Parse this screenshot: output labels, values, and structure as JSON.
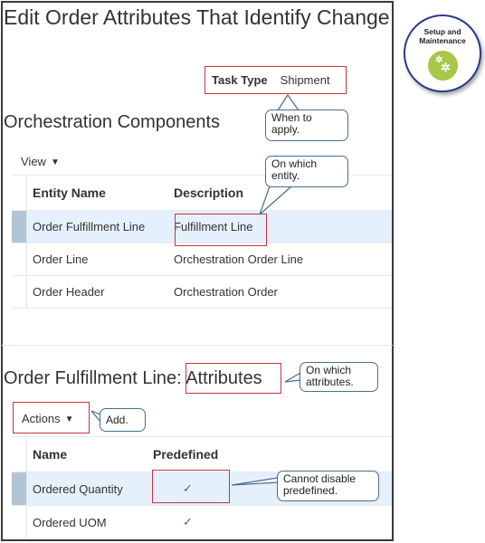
{
  "page": {
    "title": "Edit Order Attributes That Identify Change"
  },
  "task_type": {
    "label": "Task Type",
    "value": "Shipment"
  },
  "orchestration_components": {
    "title": "Orchestration Components",
    "view_menu_label": "View",
    "columns": [
      "Entity Name",
      "Description"
    ],
    "rows": [
      {
        "entity_name": "Order Fulfillment Line",
        "description": "Fulfillment Line",
        "selected": true
      },
      {
        "entity_name": "Order Line",
        "description": "Orchestration Order Line",
        "selected": false
      },
      {
        "entity_name": "Order Header",
        "description": "Orchestration Order",
        "selected": false
      }
    ]
  },
  "attributes_section": {
    "title_prefix": "Order Fulfillment Line:",
    "title_highlight": "Attributes",
    "actions_menu_label": "Actions",
    "columns": [
      "Name",
      "Predefined"
    ],
    "rows": [
      {
        "name": "Ordered Quantity",
        "predefined": "✓",
        "selected": true
      },
      {
        "name": "Ordered UOM",
        "predefined": "✓",
        "selected": false
      }
    ]
  },
  "callouts": {
    "when": "When to apply.",
    "entity": "On which entity.",
    "attributes": "On which attributes.",
    "add": "Add.",
    "cannot_disable": "Cannot disable predefined."
  },
  "badge": {
    "label": "Setup and Maintenance",
    "icon": "gears-icon",
    "colors": {
      "ring": "#2a3a8a",
      "circle": "#a8c64a"
    }
  },
  "colors": {
    "highlight_box": "#c8343c",
    "selected_row": "#e4f0fc",
    "selected_gutter": "#b3c5d4",
    "check": "#4a5a9a"
  }
}
